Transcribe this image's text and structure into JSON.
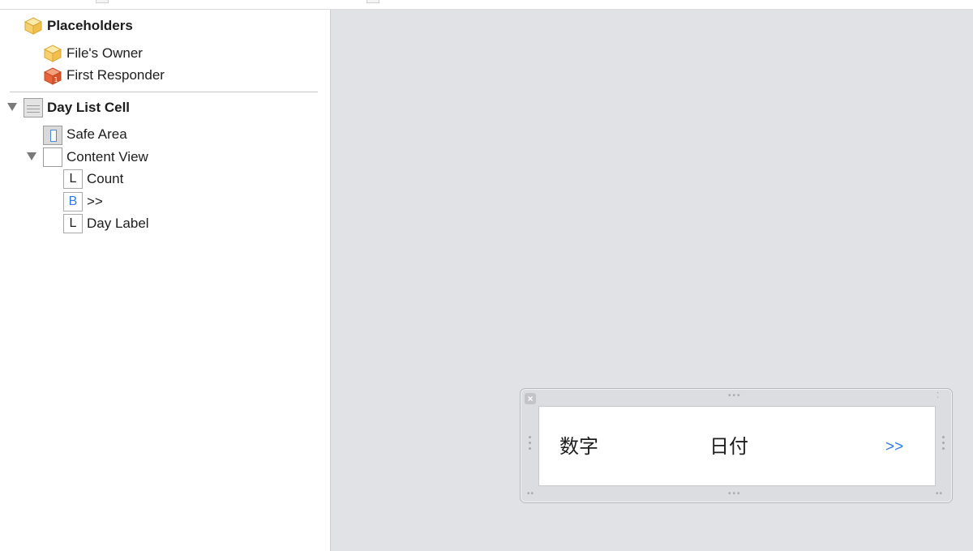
{
  "outline": {
    "placeholders_header": "Placeholders",
    "files_owner": "File's Owner",
    "first_responder": "First Responder",
    "day_list_cell": "Day List Cell",
    "safe_area": "Safe Area",
    "content_view": "Content View",
    "label_glyph": "L",
    "button_glyph": "B",
    "count_label": "Count",
    "button_label": ">>",
    "day_label": "Day Label"
  },
  "canvas": {
    "cell_count_text": "数字",
    "cell_day_text": "日付",
    "cell_button_text": ">>",
    "close_glyph": "×"
  },
  "colors": {
    "accent_blue": "#2f7ae5",
    "placeholder_yellow": "#f6c85f",
    "responder_orange": "#e8623a",
    "canvas_bg": "#e1e2e6"
  },
  "icons": {
    "placeholders": "cube-icon",
    "files_owner": "cube-icon",
    "first_responder": "first-responder-cube-icon",
    "table_cell": "table-cell-icon",
    "safe_area": "safe-area-icon",
    "view": "view-icon",
    "label": "label-icon",
    "button": "button-icon"
  }
}
